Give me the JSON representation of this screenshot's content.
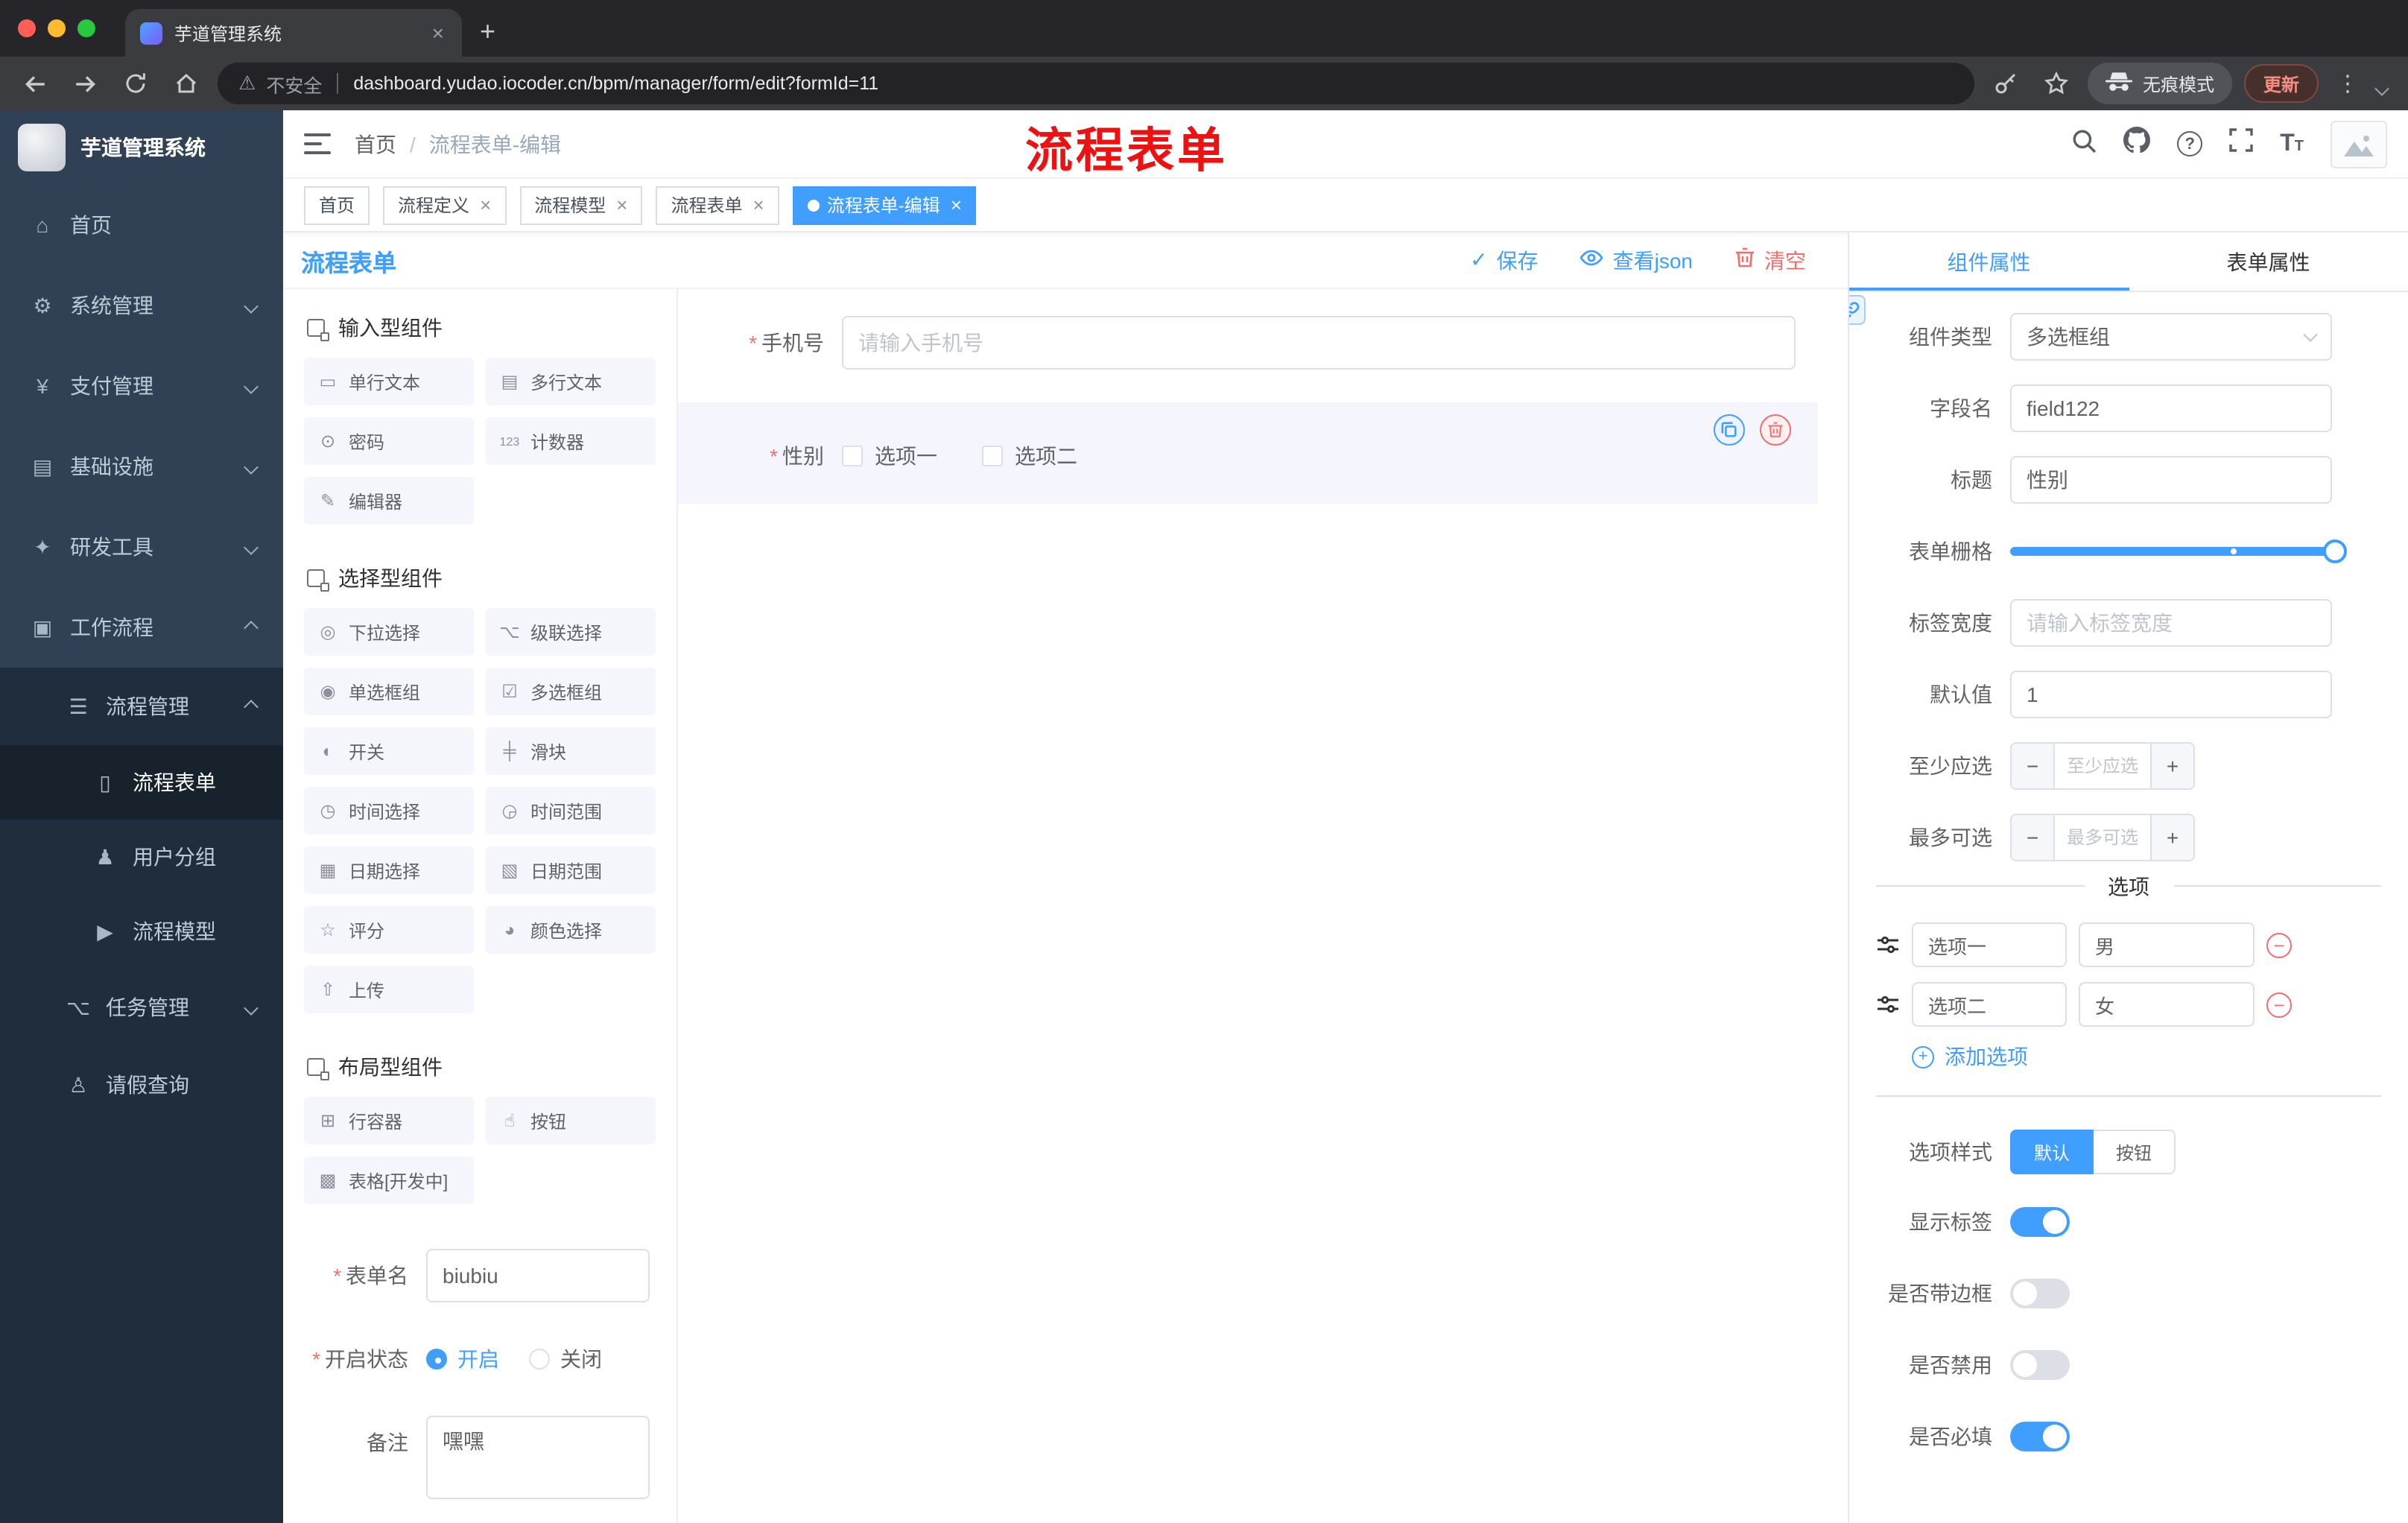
{
  "colors": {
    "accent": "#409eff",
    "danger": "#f56c6c",
    "annotation": "#ee1111",
    "sidebar_bg": "#304156"
  },
  "browser": {
    "tab_title": "芋道管理系统",
    "security_label": "不安全",
    "url": "dashboard.yudao.iocoder.cn/bpm/manager/form/edit?formId=11",
    "incognito_label": "无痕模式",
    "update_label": "更新"
  },
  "header": {
    "breadcrumb_home": "首页",
    "breadcrumb_current": "流程表单-编辑",
    "annotation": "流程表单"
  },
  "sidebar": {
    "logo_title": "芋道管理系统",
    "items": [
      {
        "glyph": "⌂",
        "label": "首页"
      },
      {
        "glyph": "⚙",
        "label": "系统管理"
      },
      {
        "glyph": "¥",
        "label": "支付管理"
      },
      {
        "glyph": "▤",
        "label": "基础设施"
      },
      {
        "glyph": "✦",
        "label": "研发工具"
      },
      {
        "glyph": "▣",
        "label": "工作流程"
      },
      {
        "glyph": "☰",
        "label": "流程管理"
      },
      {
        "glyph": "▯",
        "label": "流程表单"
      },
      {
        "glyph": "♟",
        "label": "用户分组"
      },
      {
        "glyph": "▶",
        "label": "流程模型"
      },
      {
        "glyph": "⌥",
        "label": "任务管理"
      },
      {
        "glyph": "♙",
        "label": "请假查询"
      }
    ]
  },
  "tags": {
    "items": [
      {
        "label": "首页"
      },
      {
        "label": "流程定义"
      },
      {
        "label": "流程模型"
      },
      {
        "label": "流程表单"
      },
      {
        "label": "流程表单-编辑"
      }
    ]
  },
  "designer": {
    "title": "流程表单",
    "toolbar": {
      "save": "保存",
      "view_json": "查看json",
      "clear": "清空"
    },
    "palette_groups": [
      {
        "title": "输入型组件",
        "items": [
          {
            "glyph": "▭",
            "label": "单行文本"
          },
          {
            "glyph": "▤",
            "label": "多行文本"
          },
          {
            "glyph": "⊙",
            "label": "密码"
          },
          {
            "glyph": "123",
            "label": "计数器"
          },
          {
            "glyph": "✎",
            "label": "编辑器"
          }
        ]
      },
      {
        "title": "选择型组件",
        "items": [
          {
            "glyph": "◎",
            "label": "下拉选择"
          },
          {
            "glyph": "⌥",
            "label": "级联选择"
          },
          {
            "glyph": "◉",
            "label": "单选框组"
          },
          {
            "glyph": "☑",
            "label": "多选框组"
          },
          {
            "glyph": "◐",
            "label": "开关"
          },
          {
            "glyph": "╪",
            "label": "滑块"
          },
          {
            "glyph": "◷",
            "label": "时间选择"
          },
          {
            "glyph": "◶",
            "label": "时间范围"
          },
          {
            "glyph": "▦",
            "label": "日期选择"
          },
          {
            "glyph": "▧",
            "label": "日期范围"
          },
          {
            "glyph": "☆",
            "label": "评分"
          },
          {
            "glyph": "◕",
            "label": "颜色选择"
          },
          {
            "glyph": "⇧",
            "label": "上传"
          }
        ]
      },
      {
        "title": "布局型组件",
        "items": [
          {
            "glyph": "⊞",
            "label": "行容器"
          },
          {
            "glyph": "☝",
            "label": "按钮"
          },
          {
            "glyph": "▩",
            "label": "表格[开发中]"
          }
        ]
      }
    ],
    "meta": {
      "name_label": "表单名",
      "name_value": "biubiu",
      "status_label": "开启状态",
      "status_on": "开启",
      "status_off": "关闭",
      "remark_label": "备注",
      "remark_value": "嘿嘿"
    }
  },
  "canvas": {
    "phone": {
      "label": "手机号",
      "placeholder": "请输入手机号"
    },
    "gender": {
      "label": "性别",
      "option1": "选项一",
      "option2": "选项二"
    }
  },
  "props": {
    "tab_component": "组件属性",
    "tab_form": "表单属性",
    "rows": {
      "type_label": "组件类型",
      "type_value": "多选框组",
      "field_label": "字段名",
      "field_value": "field122",
      "title_label": "标题",
      "title_value": "性别",
      "grid_label": "表单栅格",
      "width_label": "标签宽度",
      "width_placeholder": "请输入标签宽度",
      "default_label": "默认值",
      "default_value": "1",
      "min_label": "至少应选",
      "min_placeholder": "至少应选",
      "max_label": "最多可选",
      "max_placeholder": "最多可选"
    },
    "options": {
      "divider": "选项",
      "row1": {
        "label": "选项一",
        "value": "男"
      },
      "row2": {
        "label": "选项二",
        "value": "女"
      },
      "add": "添加选项"
    },
    "style": {
      "label": "选项样式",
      "default": "默认",
      "button": "按钮"
    },
    "toggles": {
      "show_label": "显示标签",
      "border_label": "是否带边框",
      "disabled_label": "是否禁用",
      "required_label": "是否必填"
    }
  }
}
